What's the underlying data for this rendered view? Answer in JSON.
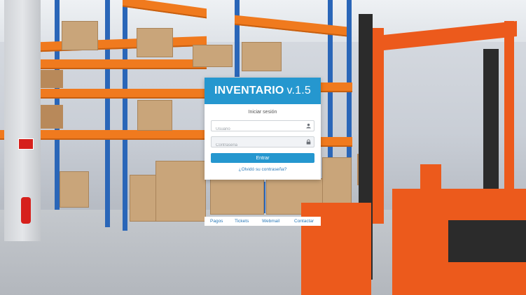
{
  "login": {
    "app_name": "INVENTARIO",
    "version": "v.1.5",
    "subtitle": "Iniciar sesión",
    "username_placeholder": "Usuario",
    "password_placeholder": "Contraseña",
    "submit_label": "Entrar",
    "forgot_label": "¿Olvidó su contraseña?"
  },
  "footer": {
    "links": [
      "Pagos",
      "Tickets",
      "Webmail",
      "Contactar"
    ]
  },
  "colors": {
    "accent": "#2597cf",
    "link": "#2a79b8"
  },
  "icons": {
    "username": "user-icon",
    "password": "lock-icon"
  }
}
